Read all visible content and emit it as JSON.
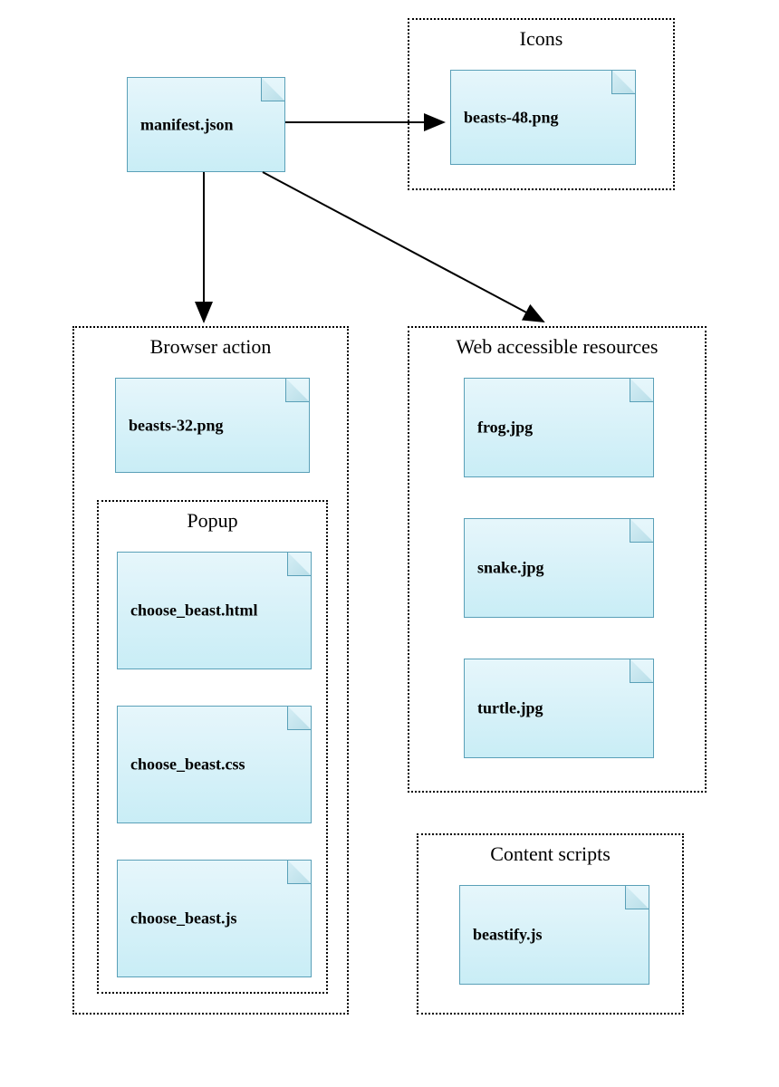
{
  "manifest": {
    "label": "manifest.json"
  },
  "groups": {
    "icons": {
      "title": "Icons",
      "files": [
        {
          "label": "beasts-48.png"
        }
      ]
    },
    "browser_action": {
      "title": "Browser action",
      "files": [
        {
          "label": "beasts-32.png"
        }
      ],
      "popup": {
        "title": "Popup",
        "files": [
          {
            "label": "choose_beast.html"
          },
          {
            "label": "choose_beast.css"
          },
          {
            "label": "choose_beast.js"
          }
        ]
      }
    },
    "web_accessible": {
      "title": "Web accessible resources",
      "files": [
        {
          "label": "frog.jpg"
        },
        {
          "label": "snake.jpg"
        },
        {
          "label": "turtle.jpg"
        }
      ]
    },
    "content_scripts": {
      "title": "Content scripts",
      "files": [
        {
          "label": "beastify.js"
        }
      ]
    }
  }
}
